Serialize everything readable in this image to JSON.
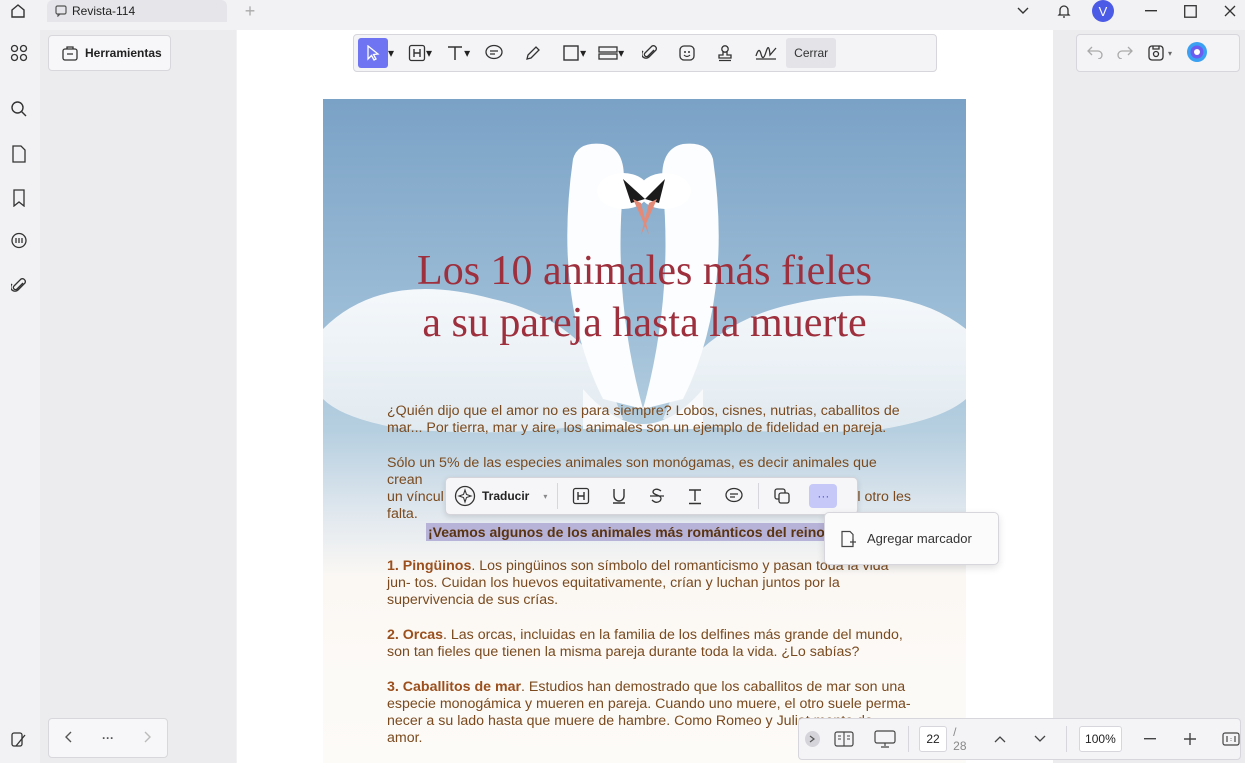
{
  "titlebar": {
    "tab_title": "Revista-114",
    "new_tab": "+",
    "avatar_letter": "V"
  },
  "panel": {
    "tools_button": "Herramientas",
    "nav_more": "···"
  },
  "toolbar": {
    "close_label": "Cerrar"
  },
  "document": {
    "title_line1": "Los 10 animales más fieles",
    "title_line2": "a su pareja hasta la muerte",
    "p1": "¿Quién dijo que el amor no es para siempre? Lobos, cisnes, nutrias, caballitos de mar... Por tierra, mar y aire, los animales son un ejemplo de fidelidad en pareja.",
    "p2_a": "Sólo un 5% de las especies animales son monógamas, es decir animales que crean",
    "p2_b": "un víncul",
    "p2_c": "l otro les",
    "p2_d": "falta.",
    "highlight": "¡Veamos algunos de los animales más románticos del reino a",
    "item1_title": "1. Pingüinos",
    "item1_text_a": ". Los pingüinos son símbolo del romanticismo y pasan toda la vida jun-",
    "item1_text_b": "tos. Cuidan los huevos equitativamente, crían y luchan juntos por la supervivencia de sus crías.",
    "item2_title": "2. Orcas",
    "item2_text": ". Las orcas, incluidas en la familia de los delfines más grande del mundo, son tan fieles que tienen la misma pareja durante toda la vida. ¿Lo sabías?",
    "item3_title": "3. Caballitos de mar",
    "item3_text_a": ". Estudios han demostrado que los caballitos de mar son una especie monogámica y mueren en pareja. Cuando uno muere, el otro suele perma-",
    "item3_text_b": "necer a su lado hasta que muere de hambre. Como Romeo y Juliet",
    "item3_text_c": "mente de amor."
  },
  "selection_bar": {
    "translate_label": "Traducir",
    "more_label": "···"
  },
  "popup": {
    "add_bookmark": "Agregar marcador"
  },
  "status": {
    "current_page": "22",
    "total_pages": "/ 28",
    "zoom": "100%"
  }
}
